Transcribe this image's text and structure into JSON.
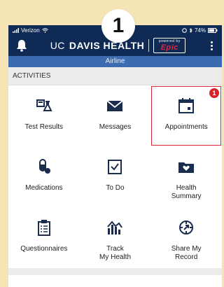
{
  "step_badge": "1",
  "statusbar": {
    "carrier": "Verizon",
    "battery": "74%"
  },
  "header": {
    "brand_uc": "UC",
    "brand_name": "DAVIS HEALTH",
    "powered_by": "powered by",
    "epic": "Epic",
    "bell_icon": "bell-icon",
    "menu_icon": "menu-dots-icon"
  },
  "subheader": {
    "text": "Airline"
  },
  "section": {
    "label": "ACTIVITIES"
  },
  "tiles": [
    {
      "label": "Test Results",
      "icon": "test-results-icon"
    },
    {
      "label": "Messages",
      "icon": "envelope-icon"
    },
    {
      "label": "Appointments",
      "icon": "calendar-icon",
      "badge": "1",
      "highlighted": true
    },
    {
      "label": "Medications",
      "icon": "pill-icon"
    },
    {
      "label": "To Do",
      "icon": "checklist-icon"
    },
    {
      "label": "Health\nSummary",
      "icon": "folder-heart-icon"
    },
    {
      "label": "Questionnaires",
      "icon": "clipboard-icon"
    },
    {
      "label": "Track\nMy Health",
      "icon": "chart-icon"
    },
    {
      "label": "Share My\nRecord",
      "icon": "share-record-icon"
    }
  ],
  "colors": {
    "header_bg": "#0f2a55",
    "subheader_bg": "#3d6bb0",
    "accent_red": "#d8232a",
    "icon_color": "#1b2d4e"
  }
}
